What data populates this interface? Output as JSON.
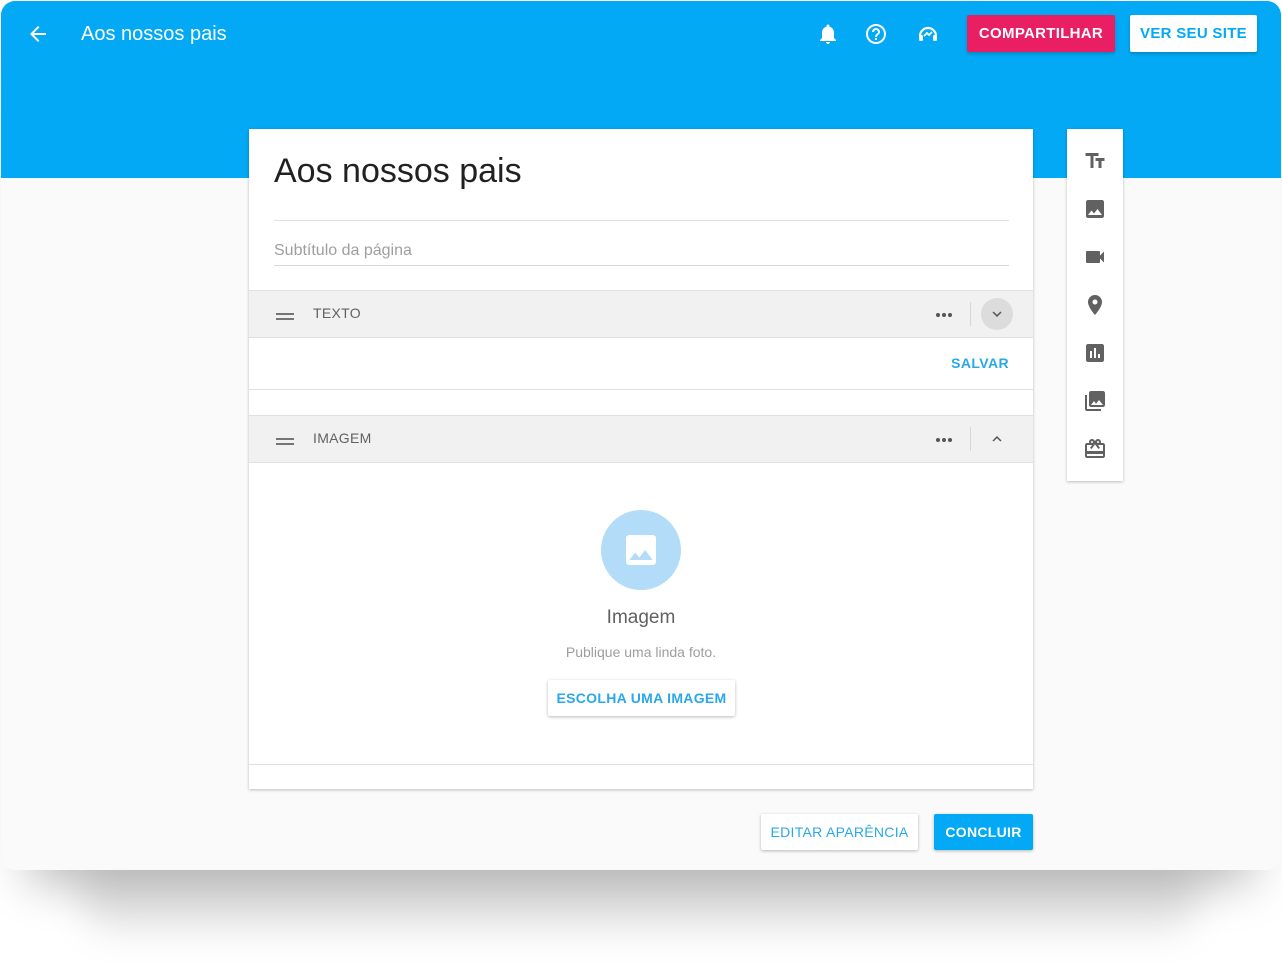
{
  "header": {
    "title": "Aos nossos pais",
    "share_label": "COMPARTILHAR",
    "view_site_label": "VER SEU SITE",
    "icons": [
      "back-arrow-icon",
      "bell-icon",
      "help-icon",
      "support-icon"
    ]
  },
  "page": {
    "title": "Aos nossos pais",
    "subtitle_placeholder": "Subtítulo da página"
  },
  "sections": {
    "text": {
      "label": "TEXTO",
      "save_label": "SALVAR"
    },
    "image": {
      "label": "IMAGEM",
      "heading": "Imagem",
      "description": "Publique uma linda foto.",
      "choose_label": "ESCOLHA UMA IMAGEM"
    }
  },
  "toolbox": {
    "tools": [
      "text-tool-icon",
      "image-tool-icon",
      "video-tool-icon",
      "map-tool-icon",
      "chart-tool-icon",
      "gallery-tool-icon",
      "gift-tool-icon"
    ]
  },
  "footer": {
    "appearance_label": "EDITAR APARÊNCIA",
    "done_label": "CONCLUIR"
  },
  "colors": {
    "primary": "#03a9f4",
    "accent": "#e91e63",
    "background": "#fafafa"
  }
}
